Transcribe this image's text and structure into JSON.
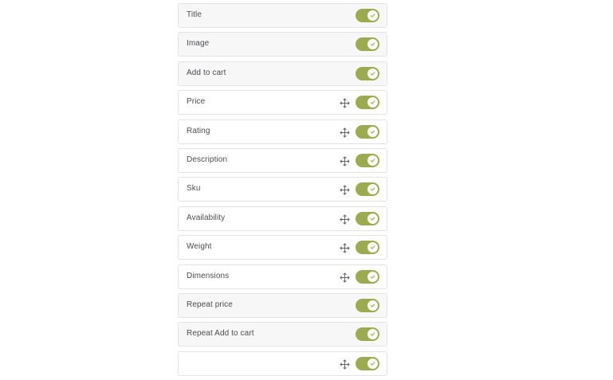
{
  "settings": {
    "items": [
      {
        "label": "Title",
        "draggable": false,
        "enabled": true
      },
      {
        "label": "Image",
        "draggable": false,
        "enabled": true
      },
      {
        "label": "Add to cart",
        "draggable": false,
        "enabled": true
      },
      {
        "label": "Price",
        "draggable": true,
        "enabled": true
      },
      {
        "label": "Rating",
        "draggable": true,
        "enabled": true
      },
      {
        "label": "Description",
        "draggable": true,
        "enabled": true
      },
      {
        "label": "Sku",
        "draggable": true,
        "enabled": true
      },
      {
        "label": "Availability",
        "draggable": true,
        "enabled": true
      },
      {
        "label": "Weight",
        "draggable": true,
        "enabled": true
      },
      {
        "label": "Dimensions",
        "draggable": true,
        "enabled": true
      },
      {
        "label": "Repeat price",
        "draggable": false,
        "enabled": true
      },
      {
        "label": "Repeat Add to cart",
        "draggable": false,
        "enabled": true
      },
      {
        "label": "",
        "draggable": true,
        "enabled": true
      }
    ]
  },
  "colors": {
    "toggle_on": "#9bab4d",
    "fixed_row_bg": "#f7f7f7",
    "row_border": "#e3e3e3",
    "label_text": "#4a4d52"
  },
  "icons": {
    "drag": "move-arrows-icon",
    "toggle_check": "check-icon"
  }
}
